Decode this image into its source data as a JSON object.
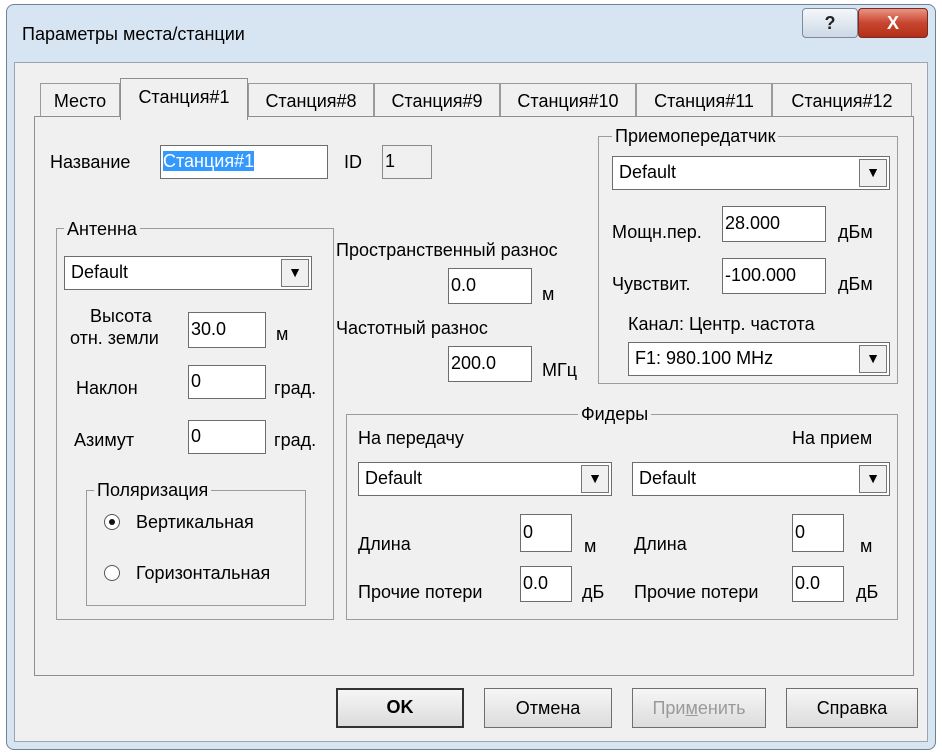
{
  "window": {
    "title": "Параметры места/станции",
    "help_label": "?",
    "close_label": "X"
  },
  "tabs": [
    {
      "label": "Место"
    },
    {
      "label": "Станция#1"
    },
    {
      "label": "Станция#8"
    },
    {
      "label": "Станция#9"
    },
    {
      "label": "Станция#10"
    },
    {
      "label": "Станция#11"
    },
    {
      "label": "Станция#12"
    }
  ],
  "station": {
    "name_label": "Название",
    "name_value": "Станция#1",
    "id_label": "ID",
    "id_value": "1"
  },
  "antenna": {
    "title": "Антенна",
    "model": "Default",
    "height_label_1": "Высота",
    "height_label_2": "отн. земли",
    "height_value": "30.0",
    "height_unit": "м",
    "tilt_label": "Наклон",
    "tilt_value": "0",
    "tilt_unit": "град.",
    "azimuth_label": "Азимут",
    "azimuth_value": "0",
    "azimuth_unit": "град.",
    "polarization": {
      "title": "Поляризация",
      "vertical_label": "Вертикальная",
      "horizontal_label": "Горизонтальная",
      "selected": "vertical"
    }
  },
  "diversity": {
    "space_label": "Пространственный разнос",
    "space_value": "0.0",
    "space_unit": "м",
    "freq_label": "Частотный разнос",
    "freq_value": "200.0",
    "freq_unit": "МГц"
  },
  "transceiver": {
    "title": "Приемопередатчик",
    "model": "Default",
    "power_label": "Мощн.пер.",
    "power_value": "28.000",
    "power_unit": "дБм",
    "sens_label": "Чувствит.",
    "sens_value": "-100.000",
    "sens_unit": "дБм",
    "channel_label": "Канал: Центр. частота",
    "channel_value": "F1: 980.100 MHz"
  },
  "feeders": {
    "title": "Фидеры",
    "tx_label": "На передачу",
    "rx_label": "На прием",
    "tx_model": "Default",
    "rx_model": "Default",
    "length_label": "Длина",
    "tx_length": "0",
    "rx_length": "0",
    "length_unit": "м",
    "loss_label": "Прочие потери",
    "tx_loss": "0.0",
    "rx_loss": "0.0",
    "loss_unit": "дБ"
  },
  "buttons": {
    "ok": "OK",
    "cancel": "Отмена",
    "apply_pre": "При",
    "apply_u": "м",
    "apply_post": "енить",
    "help": "Справка"
  },
  "icons": {
    "dropdown": "chevron-down-icon",
    "help": "question-mark-icon",
    "close": "close-icon"
  }
}
